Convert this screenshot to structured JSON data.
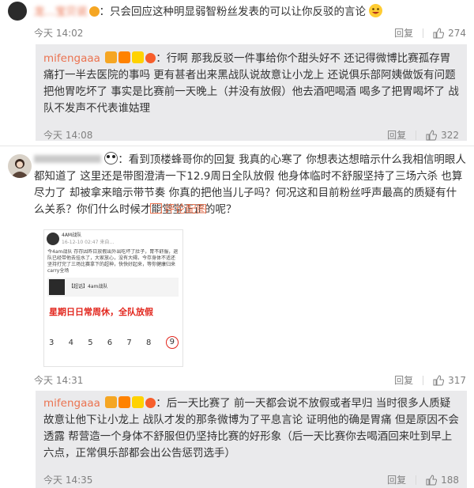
{
  "comment1": {
    "username": "龙…宝贝说",
    "text": "只会回应这种明显弱智粉丝发表的可以让你反驳的言论",
    "time": "今天 14:02",
    "reply_label": "回复",
    "likes": "274"
  },
  "reply1": {
    "username": "mifengaaa",
    "text": "行啊 那我反驳一件事给你个甜头好不 还记得微博比赛孤存胃痛打一半去医院的事吗 更有甚者出来黑战队说故意让小龙上 还说俱乐部阿姨做饭有问题把他胃吃坏了 事实是比赛前一天晚上（并没有放假）他去酒吧喝酒 喝多了把胃喝坏了 战队不发声不代表谁姑理",
    "time": "今天 14:08",
    "reply_label": "回复",
    "likes": "322"
  },
  "comment2": {
    "username": "",
    "text": "看到顶楼蜂哥你的回复 我真的心寒了 你想表达想暗示什么我相信明眼人都知道了 这里还是带图澄清一下12.9周日全队放假 他身体临时不舒服坚持了三场六杀 也算尽力了 却被拿来暗示带节奏 你真的把他当儿子吗？何况这和目前粉丝呼声最高的质疑有什么关系？你们什么时候才能堂堂正正的呢？",
    "pic_link": "评论配图",
    "time": "今天 14:31",
    "reply_label": "回复",
    "likes": "317",
    "embedded": {
      "header_name": "4AM战队",
      "header_time": "16-12-10 02:47 来自…",
      "post_text": "今4am战队  存存因昨日放假出外出吃坏了肚子，胃不舒服，退队已经带他去挂水了，大家放心，没有大碍。今存身体不适还坚持打完了三场比赛拿下的超神，快快好起来，等你健康归来carry全场",
      "card_title": "【超话】4am战队",
      "banner": "星期日日常周休，全队放假",
      "calendar": [
        "3",
        "4",
        "5",
        "6",
        "7",
        "8",
        "9"
      ]
    }
  },
  "reply2": {
    "username": "mifengaaa",
    "text": "后一天比赛了 前一天都会说不放假或者早归 当时很多人质疑故意让他下让小龙上 战队才发的那条微博为了平息言论 证明他的确是胃痛 但是原因不会透露 帮营造一个身体不舒服但仍坚持比赛的好形象（后一天比赛你去喝酒回来吐到早上六点，正常俱乐部都会出公告惩罚选手）",
    "time": "今天 14:35",
    "reply_label": "回复",
    "likes": "188"
  },
  "colors": {
    "accent": "#eb7350",
    "reply_bg": "#eaeaec",
    "banner_red": "#e2261d"
  }
}
